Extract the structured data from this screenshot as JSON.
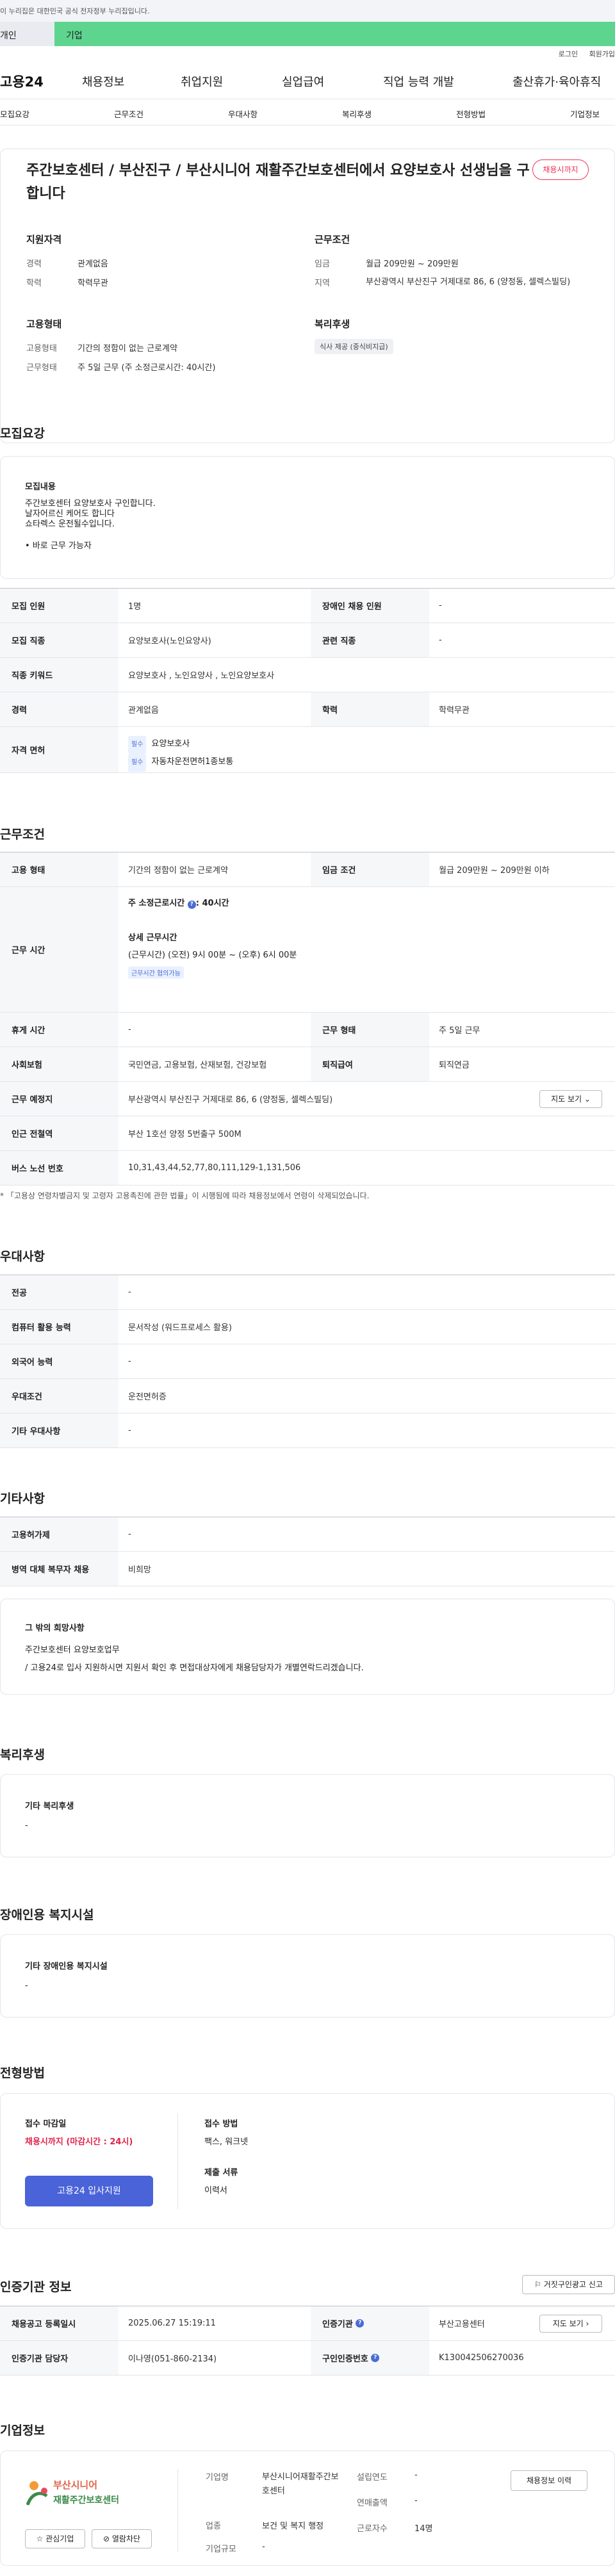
{
  "gov_banner": "이 누리집은 대한민국 공식 전자정부 누리집입니다.",
  "top_tabs": {
    "individual": "개인",
    "company": "기업"
  },
  "util": {
    "login": "로그인",
    "join": "회원가입"
  },
  "gnb": {
    "logo": "고용24",
    "menu": [
      "채용정보",
      "취업지원",
      "실업급여",
      "직업 능력 개발",
      "출산휴가·육아휴직"
    ]
  },
  "subnav": [
    "모집요강",
    "근무조건",
    "우대사항",
    "복리후생",
    "전형방법",
    "기업정보"
  ],
  "header": {
    "title": "주간보호센터 / 부산진구 / 부산시니어 재활주간보호센터에서 요양보호사 선생님을 구합니다",
    "badge": "채용시까지",
    "qual_title": "지원자격",
    "career_k": "경력",
    "career_v": "관계없음",
    "edu_k": "학력",
    "edu_v": "학력무관",
    "emp_title": "고용형태",
    "type_k": "고용형태",
    "type_v": "기간의 정함이 없는 근로계약",
    "work_k": "근무형태",
    "work_v": "주 5일 근무 (주 소정근로시간: 40시간)",
    "cond_title": "근무조건",
    "wage_k": "임금",
    "wage_v": "월급 209만원 ~ 209만원",
    "region_k": "지역",
    "region_v": "부산광역시 부산진구 거제대로 86, 6 (양정동, 셀렉스빌딩)",
    "welfare_title": "복리후생",
    "welfare_tag": "식사 제공 (중식비지급)"
  },
  "recruit": {
    "heading": "모집요강",
    "desc_title": "모집내용",
    "desc_lines": [
      "주간보호센터 요양보호사 구인합니다.",
      "날자어르신 케어도 합니다",
      "쇼타렉스 운전될수입니다."
    ],
    "desc_bullet": "• 바로 근무 가능자",
    "rows": {
      "count_k": "모집 인원",
      "count_v": "1명",
      "disabled_k": "장애인 채용 인원",
      "disabled_v": "-",
      "job_k": "모집 직종",
      "job_v": "요양보호사(노인요양사)",
      "related_k": "관련 직종",
      "related_v": "-",
      "keyword_k": "직종 키워드",
      "keyword_v": "요양보호사 , 노인요양사 , 노인요양보호사",
      "career_k": "경력",
      "career_v": "관계없음",
      "edu_k": "학력",
      "edu_v": "학력무관",
      "license_k": "자격 면허",
      "license_chip": "필수",
      "license_1": "요양보호사",
      "license_2": "자동차운전면허1종보통"
    }
  },
  "conditions": {
    "heading": "근무조건",
    "type_k": "고용 형태",
    "type_v": "기간의 정함이 없는 근로계약",
    "wage_k": "임금 조건",
    "wage_v": "월급 209만원 ~ 209만원 이하",
    "hours_k": "근무 시간",
    "hours_1": "주 소정근로시간 ",
    "hours_1b": ": 40시간",
    "hours_2": "상세 근무시간",
    "hours_3": "(근무시간) (오전) 9시 00분 ~ (오후) 6시 00분",
    "hours_chip": "근무시간 협의가능",
    "rest_k": "휴게 시간",
    "rest_v": "-",
    "workform_k": "근무 형태",
    "workform_v": "주 5일 근무",
    "insure_k": "사회보험",
    "insure_v": "국민연금, 고용보험, 산재보험, 건강보험",
    "retire_k": "퇴직급여",
    "retire_v": "퇴직연금",
    "place_k": "근무 예정지",
    "place_v": "부산광역시 부산진구 거제대로 86, 6 (양정동, 셀렉스빌딩)",
    "map_btn": "지도 보기",
    "subway_k": "인근 전철역",
    "subway_v": "부산 1호선 양정 5번출구 500M",
    "bus_k": "버스 노선 번호",
    "bus_v": "10,31,43,44,52,77,80,111,129-1,131,506",
    "note": "* 「고용상 연령차별금지 및 고령자 고용촉진에 관한 법률」이 시행됨에 따라 채용정보에서 연령이 삭제되었습니다."
  },
  "prefer": {
    "heading": "우대사항",
    "major_k": "전공",
    "major_v": "-",
    "pc_k": "컴퓨터 활용 능력",
    "pc_v": "문서작성 (워드프로세스 활용)",
    "lang_k": "외국어 능력",
    "lang_v": "-",
    "cond_k": "우대조건",
    "cond_v": "운전면허증",
    "etc_k": "기타 우대사항",
    "etc_v": "-"
  },
  "etc": {
    "heading": "기타사항",
    "device_k": "고용허가제",
    "device_v": "-",
    "military_k": "병역 대체 복무자 채용",
    "military_v": "비희망",
    "hope_title": "그 밖의 희망사항",
    "hope_1": "주간보호센터 요양보호업무",
    "hope_2": "/ 고용24로  입사 지원하시면 지원서 확인 후 면접대상자에게 채용담당자가 개별연락드리겠습니다."
  },
  "welfare": {
    "heading": "복리후생",
    "title": "기타 복리후생",
    "value": "-"
  },
  "disabled": {
    "heading": "장애인용 복지시설",
    "title": "기타 장애인용 복지시설",
    "value": "-"
  },
  "screening": {
    "heading": "전형방법",
    "deadline_k": "접수 마감일",
    "deadline_v": "채용시까지 (마감시간 : 24시)",
    "apply_btn": "고용24 입사지원",
    "method_k": "접수 방법",
    "method_v": "팩스, 워크넷",
    "docs_k": "제출 서류",
    "docs_v": "이력서"
  },
  "cert": {
    "heading": "인증기관 정보",
    "report_btn": "거짓구인광고 신고",
    "reg_k": "채용공고 등록일시",
    "reg_v": "2025.06.27 15:19:11",
    "agency_k": "인증기관",
    "agency_v": "부산고용센터",
    "agency_map": "지도 보기",
    "manager_k": "인증기관 담당자",
    "manager_v": "이나영(051-860-2134)",
    "id_k": "구인인증번호",
    "id_v": "K130042506270036"
  },
  "company": {
    "heading": "기업정보",
    "logo_text_1": "부산시니어",
    "logo_text_2": "재활주간보호센터",
    "interest_btn": "관심기업",
    "block_btn": "열람차단",
    "name_k": "기업명",
    "name_v": "부산시니어재활주간보호센터",
    "year_k": "설립연도",
    "year_v": "-",
    "sales_k": "연매출액",
    "sales_v": "-",
    "industry_k": "업종",
    "industry_v": "보건 및 복지 행정",
    "emp_k": "근로자수",
    "emp_v": "14명",
    "size_k": "기업규모",
    "size_v": "-",
    "history_btn": "채용정보 이력"
  }
}
